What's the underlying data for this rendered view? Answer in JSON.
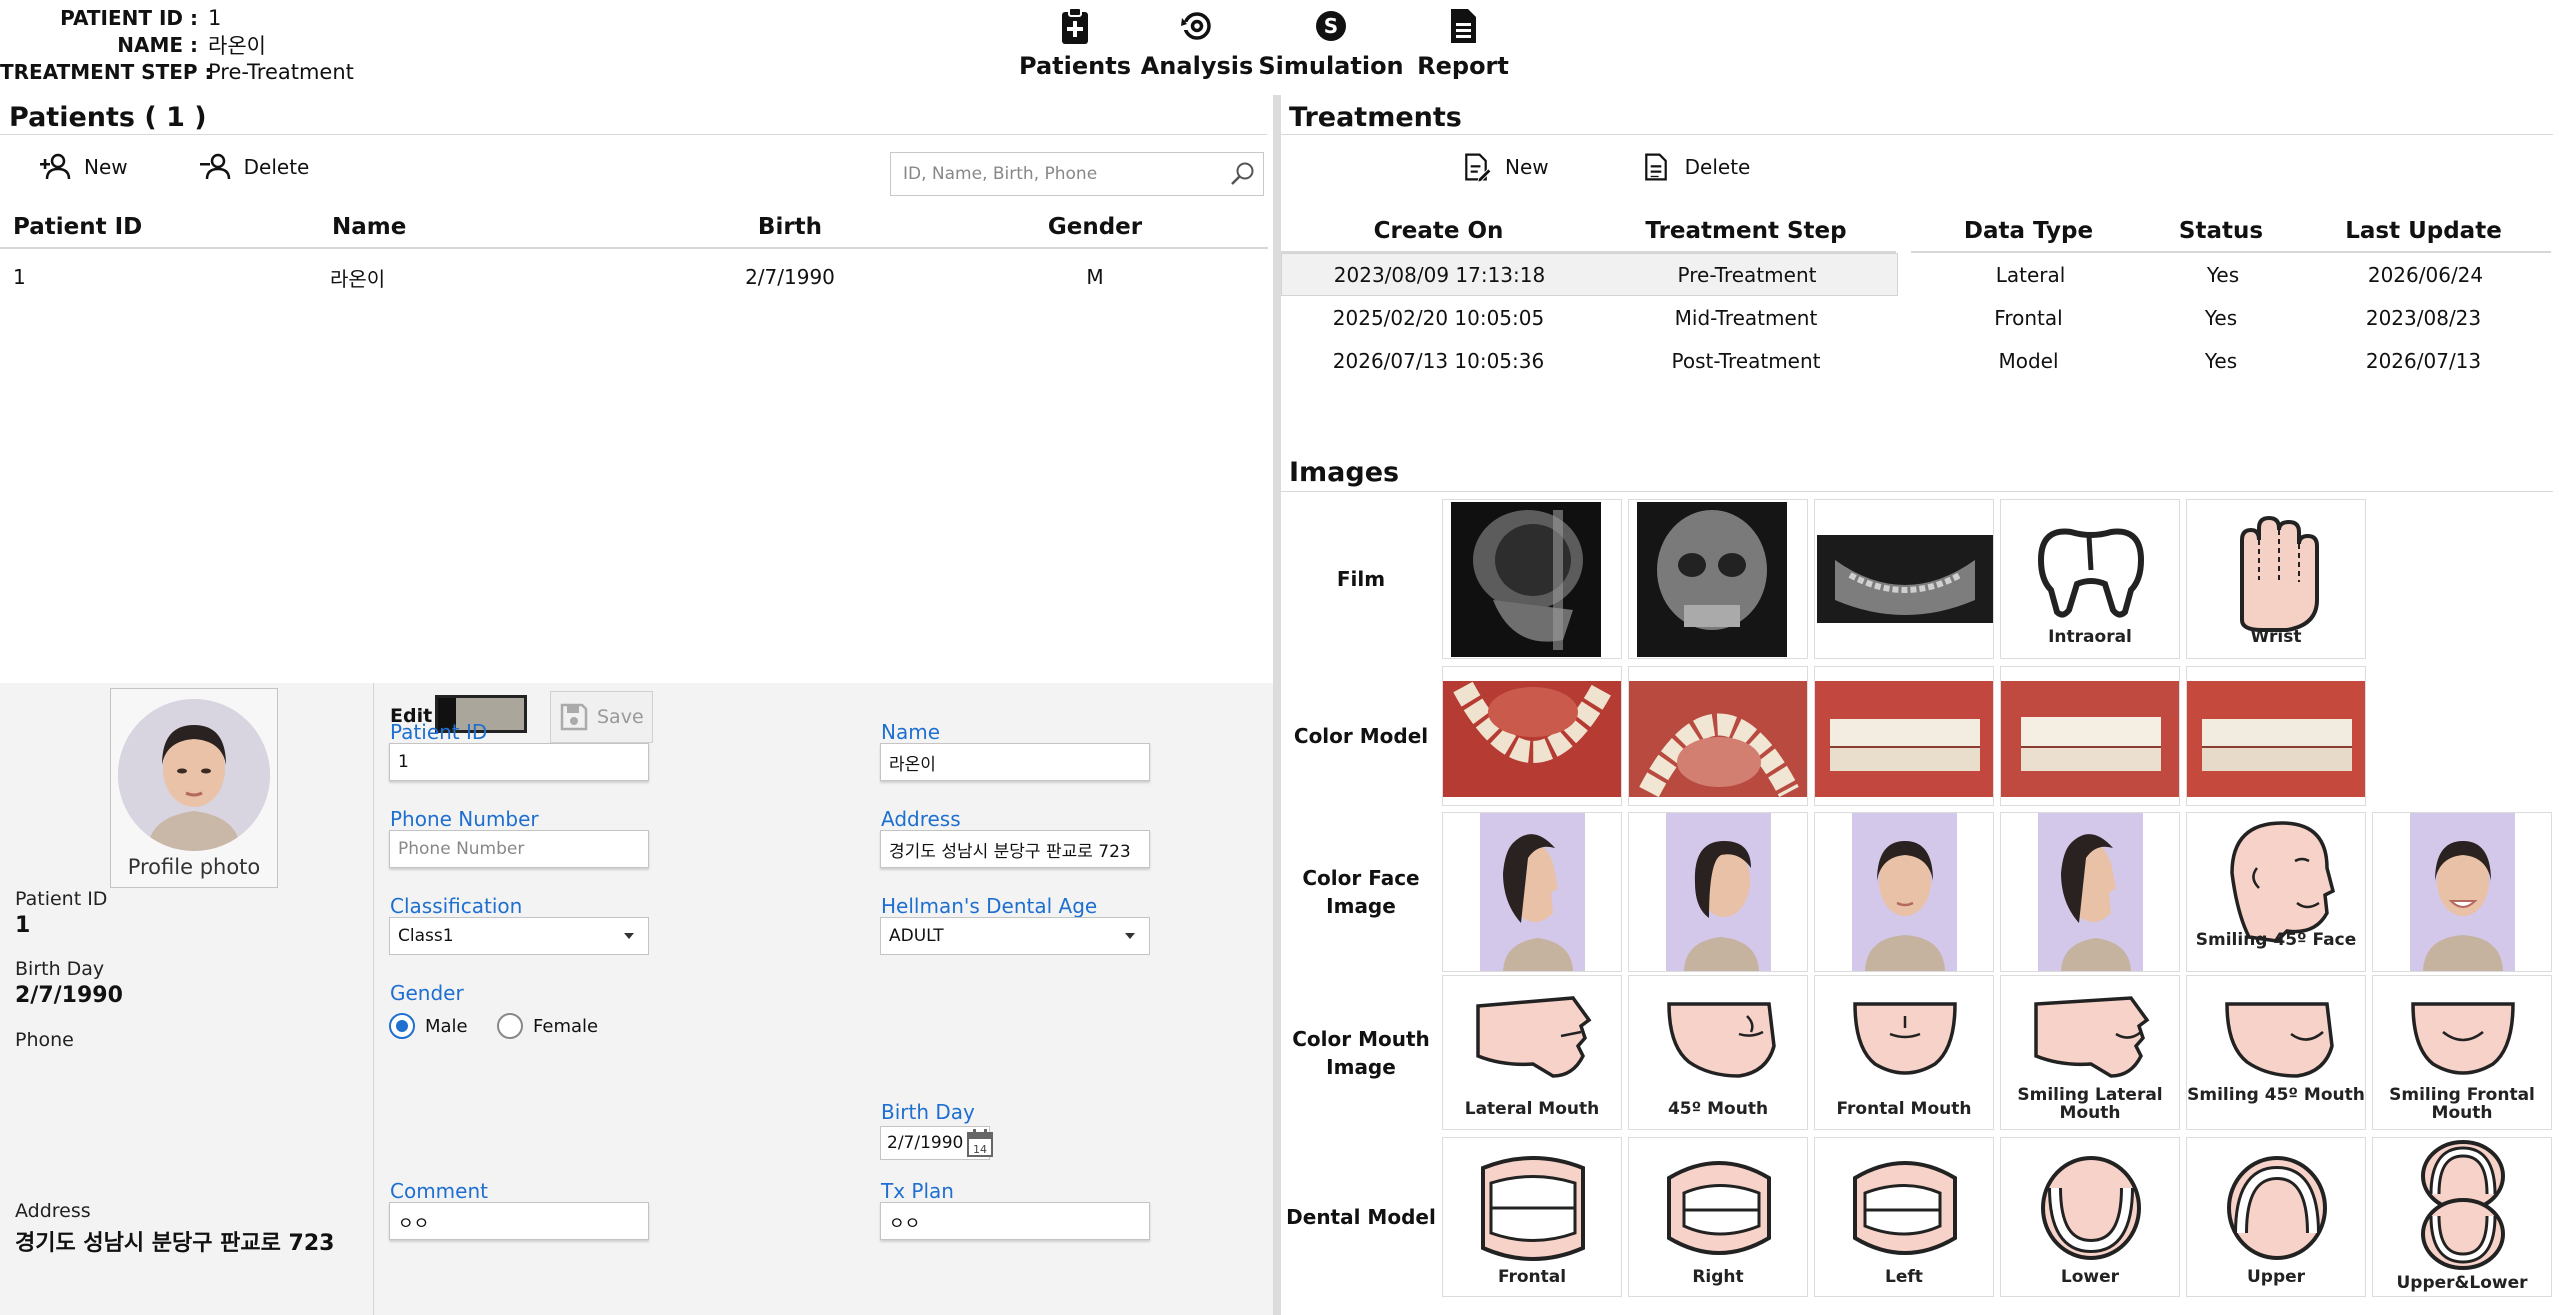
{
  "header": {
    "patient_id_label": "PATIENT ID :",
    "patient_id_value": "1",
    "name_label": "NAME :",
    "name_value": "라온이",
    "treatment_step_label": "TREATMENT STEP :",
    "treatment_step_value": "Pre-Treatment"
  },
  "nav": [
    {
      "label": "Patients",
      "icon": "clipboard-plus-icon"
    },
    {
      "label": "Analysis",
      "icon": "analysis-icon"
    },
    {
      "label": "Simulation",
      "icon": "dollar-circle-icon"
    },
    {
      "label": "Report",
      "icon": "document-icon"
    }
  ],
  "patients": {
    "title": "Patients ( 1 )",
    "new_label": "New",
    "delete_label": "Delete",
    "search_placeholder": "ID, Name, Birth, Phone",
    "columns": [
      "Patient ID",
      "Name",
      "Birth",
      "Gender"
    ],
    "rows": [
      {
        "id": "1",
        "name": "라온이",
        "birth": "2/7/1990",
        "gender": "M"
      }
    ]
  },
  "detail": {
    "profile_label": "Profile photo",
    "patient_id_label": "Patient ID",
    "patient_id_value": "1",
    "birth_day_label": "Birth Day",
    "birth_day_value": "2/7/1990",
    "phone_label": "Phone",
    "phone_value": "",
    "address_label": "Address",
    "address_value": "경기도 성남시 분당구 판교로 723",
    "edit_label": "Edit",
    "save_label": "Save",
    "form": {
      "patient_id_label": "Patient ID",
      "patient_id_value": "1",
      "name_label": "Name",
      "name_value": "라온이",
      "phone_label": "Phone Number",
      "phone_placeholder": "Phone Number",
      "address_label": "Address",
      "address_value": "경기도 성남시 분당구 판교로 723",
      "classification_label": "Classification",
      "classification_value": "Class1",
      "dental_age_label": "Hellman's Dental Age",
      "dental_age_value": "ADULT",
      "gender_label": "Gender",
      "gender_male": "Male",
      "gender_female": "Female",
      "gender_selected": "Male",
      "birthday_label": "Birth Day",
      "birthday_value": "2/7/1990",
      "comment_label": "Comment",
      "comment_value": "ㅇㅇ",
      "txplan_label": "Tx Plan",
      "txplan_value": "ㅇㅇ"
    }
  },
  "treatments": {
    "title": "Treatments",
    "new_label": "New",
    "delete_label": "Delete",
    "columns": [
      "Create On",
      "Treatment Step",
      "Data Type",
      "Status",
      "Last Update"
    ],
    "rows": [
      {
        "create_on": "2023/08/09 17:13:18",
        "step": "Pre-Treatment",
        "data_type": "Lateral",
        "status": "Yes",
        "last_update": "2026/06/24"
      },
      {
        "create_on": "2025/02/20 10:05:05",
        "step": "Mid-Treatment",
        "data_type": "Frontal",
        "status": "Yes",
        "last_update": "2023/08/23"
      },
      {
        "create_on": "2026/07/13 10:05:36",
        "step": "Post-Treatment",
        "data_type": "Model",
        "status": "Yes",
        "last_update": "2026/07/13"
      }
    ]
  },
  "images": {
    "title": "Images",
    "rows": [
      {
        "label": "Film",
        "captions": [
          "",
          "",
          "",
          "Intraoral",
          "Wrist"
        ]
      },
      {
        "label": "Color Model",
        "captions": [
          "",
          "",
          "",
          "",
          ""
        ]
      },
      {
        "label": "Color Face Image",
        "captions": [
          "",
          "",
          "",
          "",
          "Smiling 45º Face",
          ""
        ]
      },
      {
        "label": "Color Mouth Image",
        "captions": [
          "Lateral Mouth",
          "45º Mouth",
          "Frontal Mouth",
          "Smiling Lateral Mouth",
          "Smiling 45º Mouth",
          "Smiling Frontal Mouth"
        ]
      },
      {
        "label": "Dental Model",
        "captions": [
          "Frontal",
          "Right",
          "Left",
          "Lower",
          "Upper",
          "Upper&Lower"
        ]
      }
    ]
  },
  "colors": {
    "accent": "#1e6fd0",
    "divider": "#dcdcdc",
    "selected_row": "#f1f1f1",
    "skin": "#f6d2c8",
    "face_bg": "#d3c8ea"
  }
}
